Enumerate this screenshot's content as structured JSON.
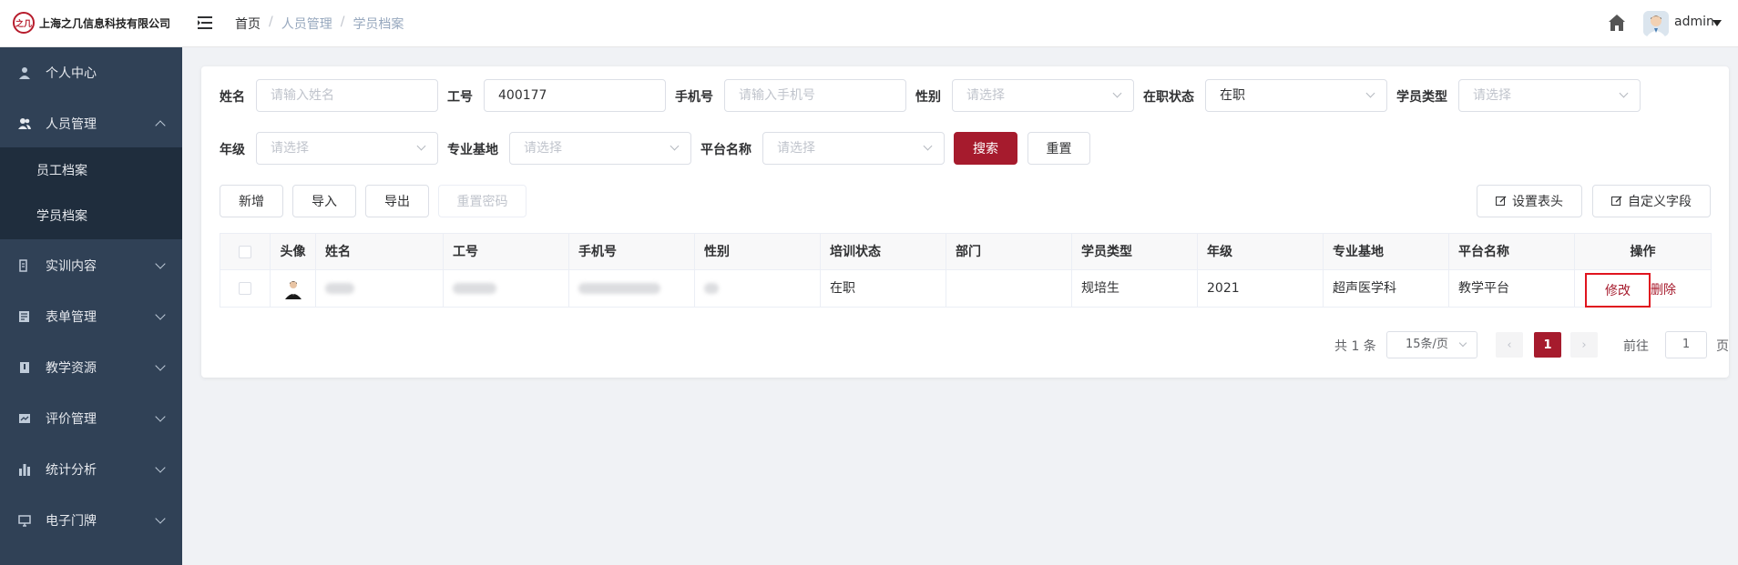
{
  "header": {
    "logo_mark": "之几",
    "company": "上海之几信息科技有限公司",
    "breadcrumb": [
      "首页",
      "人员管理",
      "学员档案"
    ],
    "breadcrumb_sep": "/",
    "username": "admin"
  },
  "sidebar": {
    "items": [
      {
        "label": "个人中心",
        "icon": "user-icon"
      },
      {
        "label": "人员管理",
        "icon": "people-icon"
      },
      {
        "label": "实训内容",
        "icon": "training-icon"
      },
      {
        "label": "表单管理",
        "icon": "form-icon"
      },
      {
        "label": "教学资源",
        "icon": "book-icon"
      },
      {
        "label": "评价管理",
        "icon": "evaluation-icon"
      },
      {
        "label": "统计分析",
        "icon": "chart-icon"
      },
      {
        "label": "电子门牌",
        "icon": "monitor-icon"
      }
    ],
    "subitems": [
      {
        "label": "员工档案"
      },
      {
        "label": "学员档案"
      }
    ]
  },
  "filters": {
    "name": {
      "label": "姓名",
      "placeholder": "请输入姓名"
    },
    "job_no": {
      "label": "工号",
      "value": "400177"
    },
    "phone": {
      "label": "手机号",
      "placeholder": "请输入手机号"
    },
    "gender": {
      "label": "性别",
      "placeholder": "请选择"
    },
    "status": {
      "label": "在职状态",
      "value": "在职"
    },
    "student_type": {
      "label": "学员类型",
      "placeholder": "请选择"
    },
    "grade": {
      "label": "年级",
      "placeholder": "请选择"
    },
    "base": {
      "label": "专业基地",
      "placeholder": "请选择"
    },
    "platform": {
      "label": "平台名称",
      "placeholder": "请选择"
    },
    "search_label": "搜索",
    "reset_label": "重置"
  },
  "toolbar": {
    "add": "新增",
    "import": "导入",
    "export": "导出",
    "reset_pwd": "重置密码",
    "set_header": "设置表头",
    "custom_field": "自定义字段"
  },
  "table": {
    "columns": [
      "头像",
      "姓名",
      "工号",
      "手机号",
      "性别",
      "培训状态",
      "部门",
      "学员类型",
      "年级",
      "专业基地",
      "平台名称",
      "操作"
    ],
    "rows": [
      {
        "train_status": "在职",
        "dept": "",
        "student_type": "规培生",
        "grade": "2021",
        "base": "超声医学科",
        "platform": "教学平台",
        "edit": "修改",
        "delete": "删除"
      }
    ]
  },
  "pagination": {
    "total": "共 1 条",
    "page_size": "15条/页",
    "prev": "‹",
    "current": "1",
    "next": "›",
    "goto": "前往",
    "goto_value": "1",
    "page_unit": "页"
  },
  "colors": {
    "accent": "#a61b2d",
    "sidebar": "#304156",
    "sidebar_sub": "#1f2d3d"
  }
}
